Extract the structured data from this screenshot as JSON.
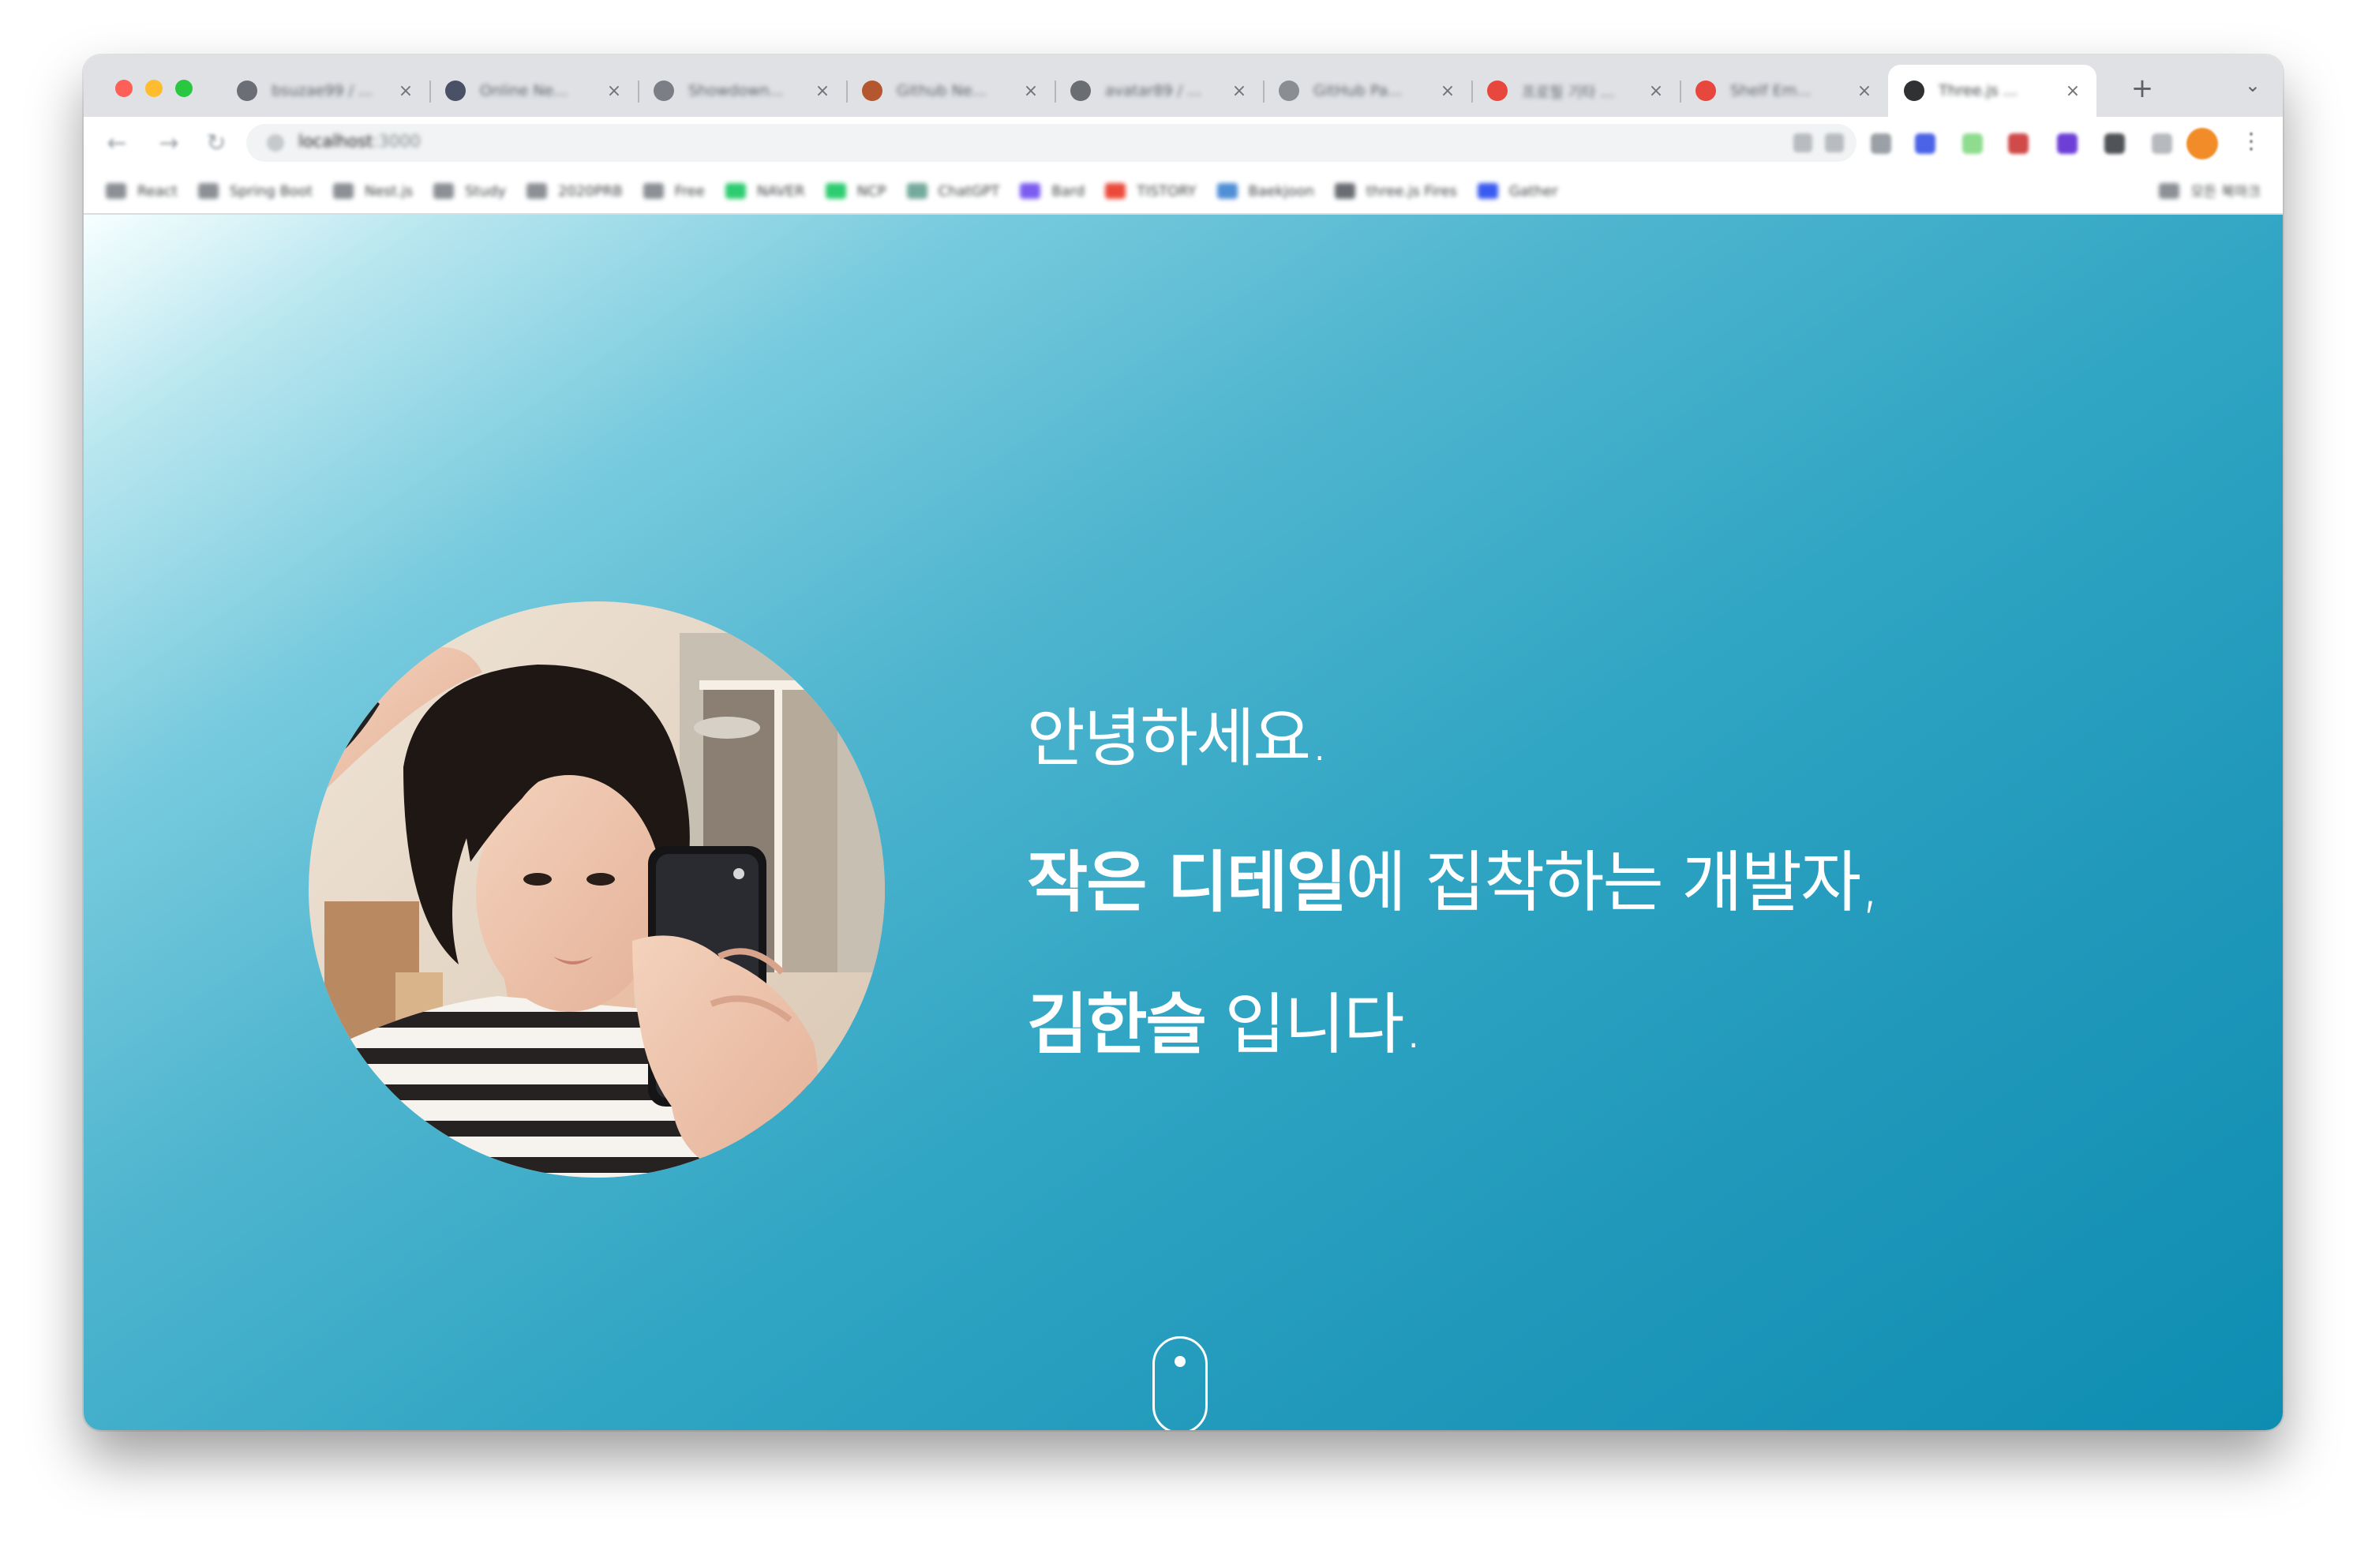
{
  "browser": {
    "tabs": [
      {
        "title": "bsuzae99 / ...",
        "favicon_color": "#6b6f75"
      },
      {
        "title": "Online Ne...",
        "favicon_color": "#4a5066"
      },
      {
        "title": "Showdown...",
        "favicon_color": "#7b7f85"
      },
      {
        "title": "Github Ne...",
        "favicon_color": "#b4562e"
      },
      {
        "title": "avatar89 / ...",
        "favicon_color": "#6a6e73"
      },
      {
        "title": "GitHub Pa...",
        "favicon_color": "#8a8e93"
      },
      {
        "title": "프로필 기타 ...",
        "favicon_color": "#e8473d"
      },
      {
        "title": "Shelf Em...",
        "favicon_color": "#e8473d"
      },
      {
        "title": "Three.js ...",
        "favicon_color": "#2f3133"
      }
    ],
    "active_tab_index": 8,
    "url": {
      "host": "localhost",
      "port": ":3000"
    },
    "bookmarks": [
      {
        "label": "React",
        "icon_color": "#8c9095"
      },
      {
        "label": "Spring Boot",
        "icon_color": "#8c9095"
      },
      {
        "label": "Nest.js",
        "icon_color": "#8c9095"
      },
      {
        "label": "Study",
        "icon_color": "#8c9095"
      },
      {
        "label": "2020PRB",
        "icon_color": "#8c9095"
      },
      {
        "label": "Free",
        "icon_color": "#8c9095"
      },
      {
        "label": "NAVER",
        "icon_color": "#2ecc71"
      },
      {
        "label": "NCP",
        "icon_color": "#2ecc71"
      },
      {
        "label": "ChatGPT",
        "icon_color": "#74aa9c"
      },
      {
        "label": "Bard",
        "icon_color": "#7b5cf0"
      },
      {
        "label": "TISTORY",
        "icon_color": "#eb4a3b"
      },
      {
        "label": "Baekjoon",
        "icon_color": "#4f8fd6"
      },
      {
        "label": "three.js Fires",
        "icon_color": "#6a6e73"
      },
      {
        "label": "Gather",
        "icon_color": "#3a5bf0"
      }
    ],
    "other_bookmarks": "모든 북마크"
  },
  "hero": {
    "greeting": "안녕하세요.",
    "line2_strong": "작은 디테일",
    "line2_rest": "에 집착하는 개발자,",
    "line3_strong": "김한슬",
    "line3_rest": " 입니다."
  },
  "colors": {
    "accent": "#1a9bbd",
    "text_on_hero": "#ffffff"
  }
}
